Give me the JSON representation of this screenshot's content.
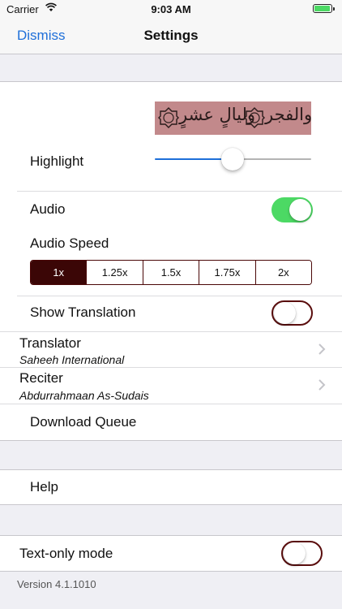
{
  "status_bar": {
    "carrier": "Carrier",
    "time": "9:03 AM"
  },
  "nav": {
    "left_button": "Dismiss",
    "title": "Settings"
  },
  "highlight": {
    "label": "Highlight",
    "slider_value": 0.49
  },
  "audio": {
    "label": "Audio",
    "enabled": true
  },
  "audio_speed": {
    "label": "Audio Speed",
    "options": [
      "1x",
      "1.25x",
      "1.5x",
      "1.75x",
      "2x"
    ],
    "selected": "1x"
  },
  "show_translation": {
    "label": "Show Translation",
    "enabled": false
  },
  "translator": {
    "label": "Translator",
    "value": "Saheeh International"
  },
  "reciter": {
    "label": "Reciter",
    "value": "Abdurrahmaan As-Sudais"
  },
  "download_queue": {
    "label": "Download Queue"
  },
  "help": {
    "label": "Help"
  },
  "text_only_mode": {
    "label": "Text-only mode",
    "enabled": false
  },
  "footer": {
    "version": "Version 4.1.1010"
  },
  "colors": {
    "accent_blue": "#1e6fd9",
    "brand_maroon": "#3b0606",
    "switch_green": "#4cd964",
    "preview_bg": "#c2898b"
  }
}
